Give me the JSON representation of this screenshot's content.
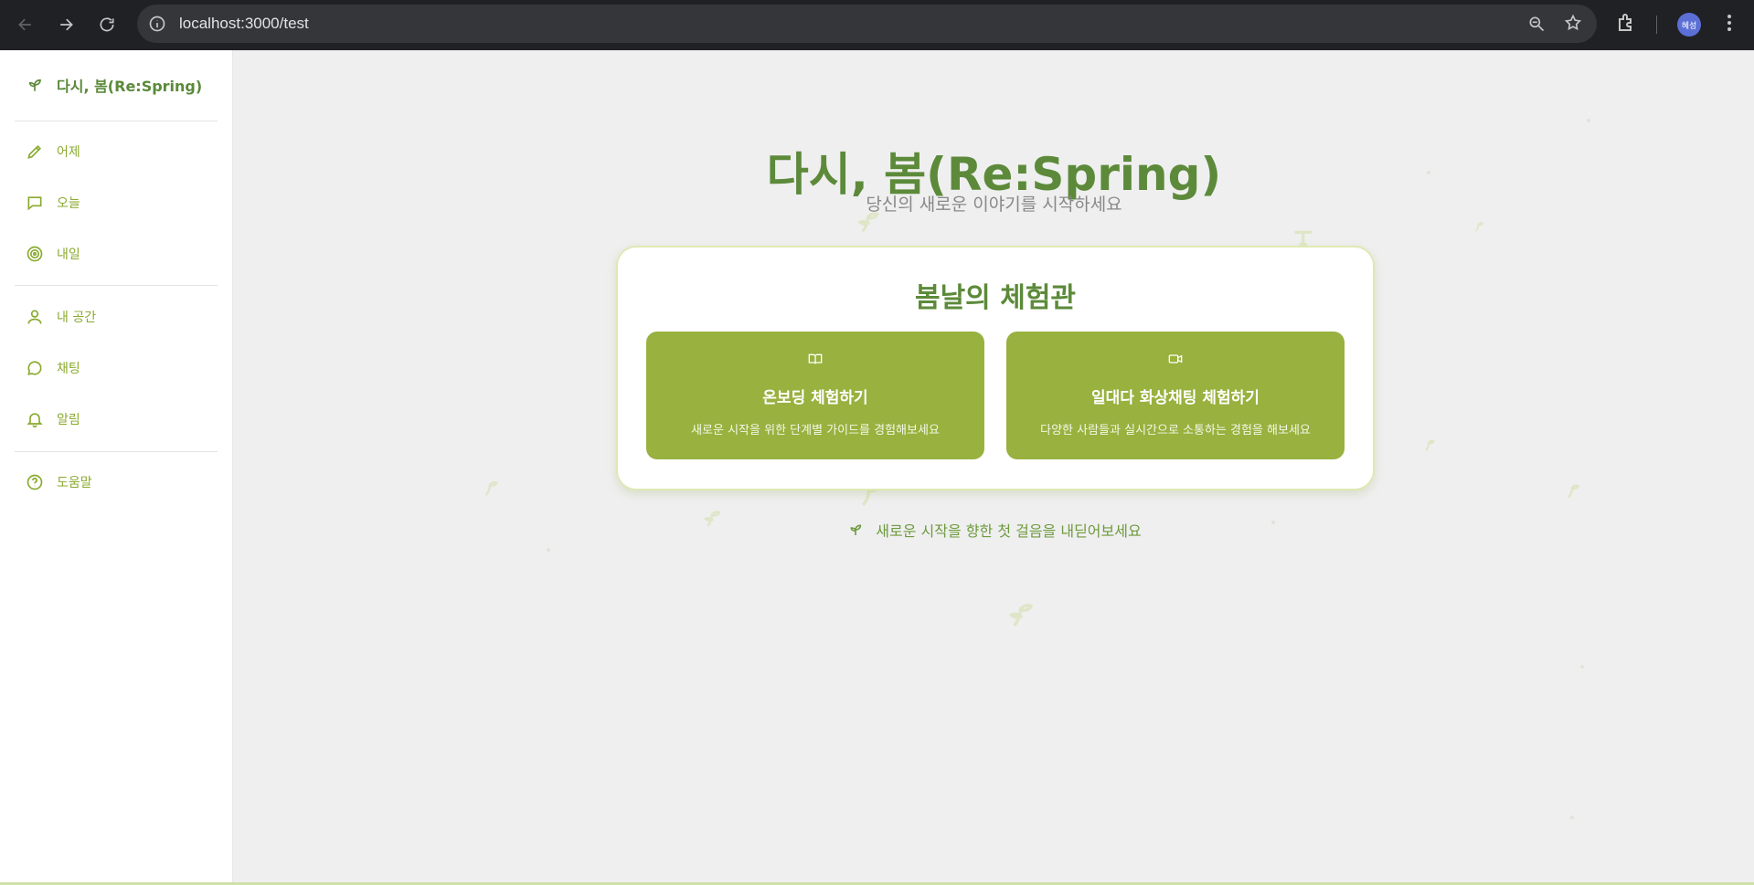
{
  "browser": {
    "url": "localhost:3000/test",
    "profile_initials": "혜성"
  },
  "sidebar": {
    "brand": "다시, 봄(Re:Spring)",
    "groups": [
      [
        {
          "label": "어제",
          "icon": "pencil-icon"
        },
        {
          "label": "오늘",
          "icon": "message-square-icon"
        },
        {
          "label": "내일",
          "icon": "target-icon"
        }
      ],
      [
        {
          "label": "내 공간",
          "icon": "user-icon"
        },
        {
          "label": "채팅",
          "icon": "chat-bubble-icon"
        },
        {
          "label": "알림",
          "icon": "bell-icon"
        }
      ],
      [
        {
          "label": "도움말",
          "icon": "help-circle-icon"
        }
      ]
    ]
  },
  "main": {
    "title": "다시, 봄(Re:Spring)",
    "subtitle": "당신의 새로운 이야기를 시작하세요",
    "card": {
      "title": "봄날의 체험관",
      "actions": [
        {
          "icon": "book-open-icon",
          "title": "온보딩 체험하기",
          "description": "새로운 시작을 위한 단계별 가이드를 경험해보세요"
        },
        {
          "icon": "video-icon",
          "title": "일대다 화상채팅 체험하기",
          "description": "다양한 사람들과 실시간으로 소통하는 경험을 해보세요"
        }
      ]
    },
    "footer": "새로운 시작을 향한 첫 걸음을 내딛어보세요"
  },
  "colors": {
    "accent_green": "#98b13f",
    "title_green": "#5c8a3a",
    "sidebar_text": "#8aaa2f"
  }
}
